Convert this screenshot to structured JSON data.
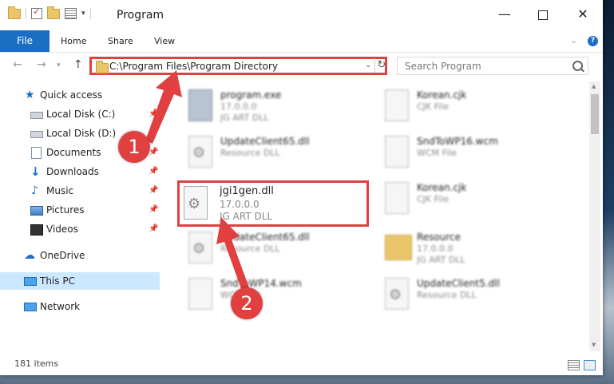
{
  "window": {
    "title": "Program",
    "minimize_glyph": "—",
    "close_glyph": "✕"
  },
  "ribbon": {
    "file_tab": "File",
    "tabs": [
      "Home",
      "Share",
      "View"
    ]
  },
  "address_bar": {
    "path": "C:\\Program Files\\Program Directory",
    "refresh_glyph": "↻"
  },
  "search": {
    "placeholder": "Search Program"
  },
  "sidebar": {
    "quick_access": "Quick access",
    "items": [
      {
        "label": "Local Disk (C:)",
        "icon": "drive-icon"
      },
      {
        "label": "Local Disk (D:)",
        "icon": "drive-icon"
      },
      {
        "label": "Documents",
        "icon": "documents-icon"
      },
      {
        "label": "Downloads",
        "icon": "download-icon"
      },
      {
        "label": "Music",
        "icon": "music-icon"
      },
      {
        "label": "Pictures",
        "icon": "pictures-icon"
      },
      {
        "label": "Videos",
        "icon": "videos-icon"
      }
    ],
    "onedrive": "OneDrive",
    "this_pc": "This PC",
    "network": "Network"
  },
  "files": [
    {
      "name": "program.exe",
      "line2": "17.0.0.0",
      "line3": "JG ART DLL",
      "icon": "exe-icon"
    },
    {
      "name": "Korean.cjk",
      "line2": "CJK File",
      "line3": "",
      "icon": "file-icon"
    },
    {
      "name": "UpdateClient65.dll",
      "line2": "Resource DLL",
      "line3": "",
      "icon": "dll-icon"
    },
    {
      "name": "SndToWP16.wcm",
      "line2": "WCM File",
      "line3": "",
      "icon": "file-icon"
    },
    {
      "name": "Korean.cjk",
      "line2": "CJK File",
      "line3": "",
      "icon": "file-icon"
    },
    {
      "name": "UpdateClient65.dll",
      "line2": "Resource DLL",
      "line3": "",
      "icon": "dll-icon"
    },
    {
      "name": "Resource",
      "line2": "17.0.0.0",
      "line3": "JG ART DLL",
      "icon": "folder-icon"
    },
    {
      "name": "SndToWP14.wcm",
      "line2": "WCM File",
      "line3": "",
      "icon": "file-icon"
    },
    {
      "name": "UpdateClient5.dll",
      "line2": "Resource DLL",
      "line3": "",
      "icon": "dll-icon"
    }
  ],
  "highlighted_file": {
    "name": "jgi1gen.dll",
    "version": "17.0.0.0",
    "description": "JG ART DLL"
  },
  "status": {
    "item_count": "181 items"
  },
  "annotations": {
    "step1": "1",
    "step2": "2",
    "color": "#e04040"
  }
}
